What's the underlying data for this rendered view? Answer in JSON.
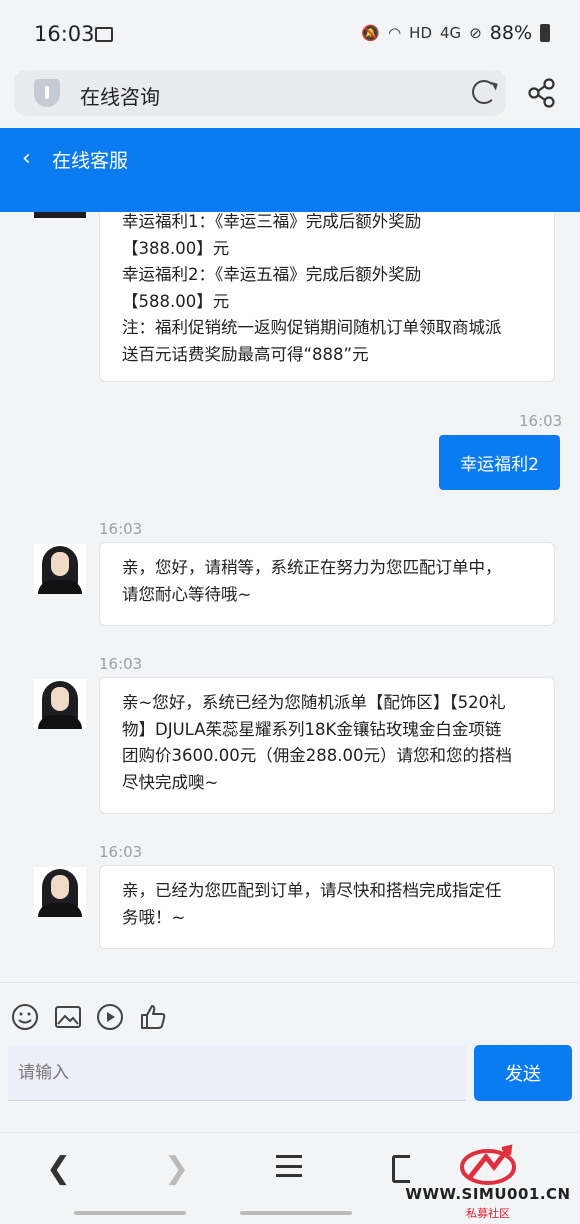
{
  "status": {
    "time": "16:03",
    "network_label": "HD",
    "signal_label": "4G",
    "battery": "88%"
  },
  "browser": {
    "page_title": "在线咨询"
  },
  "header": {
    "back_symbol": "‹",
    "title": "在线客服"
  },
  "messages": {
    "first_bubble": "幸运福利1：《幸运三福》完成后额外奖励\n【388.00】元\n幸运福利2：《幸运五福》完成后额外奖励\n【588.00】元\n注：福利促销统一返购促销期间随机订单领取商城派\n送百元话费奖励最高可得“888”元",
    "user_time": "16:03",
    "user_text": "幸运福利2",
    "agent1_time": "16:03",
    "agent1_text": "亲，您好，请稍等，系统正在努力为您匹配订单中，\n请您耐心等待哦~",
    "agent2_time": "16:03",
    "agent2_text": "亲~您好，系统已经为您随机派单【配饰区】【520礼\n物】DJULA茱蕊星耀系列18K金镶钻玫瑰金白金项链\n团购价3600.00元（佣金288.00元）请您和您的搭档\n尽快完成噢~",
    "agent3_time": "16:03",
    "agent3_text": "亲，已经为您匹配到订单，请尽快和搭档完成指定任\n务哦！~"
  },
  "composer": {
    "placeholder": "请输入",
    "send_label": "发送"
  },
  "watermark": {
    "site": "WWW.SIMU001.CN",
    "tagline": "私募社区"
  },
  "colors": {
    "accent": "#0b7bf2"
  }
}
